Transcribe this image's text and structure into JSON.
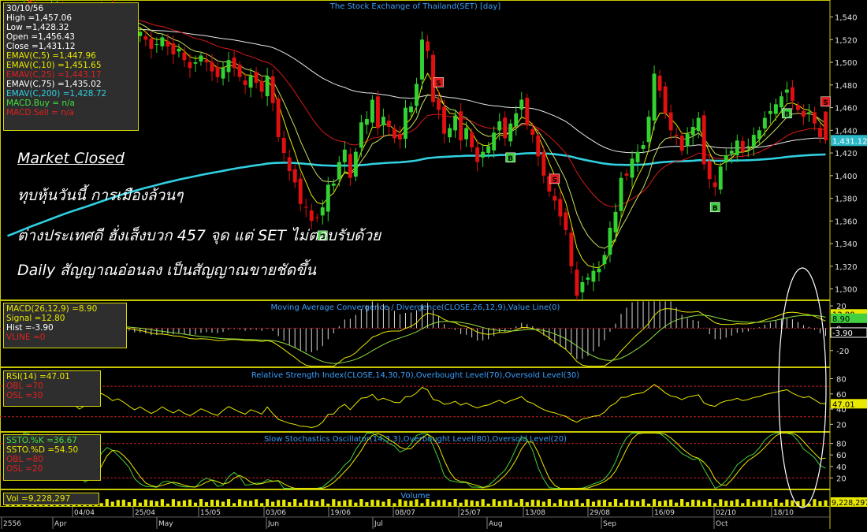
{
  "chart_data": [
    {
      "type": "candlestick",
      "title": "The Stock Exchange of Thailand(SET) [day]",
      "yticks": [
        1300,
        1320,
        1340,
        1360,
        1380,
        1400,
        1420,
        1440,
        1460,
        1480,
        1500,
        1520,
        1540
      ],
      "ylim": [
        1290,
        1555
      ],
      "last_value_label": "1,431.12",
      "ytick_labels": [
        "1,300",
        "1,320",
        "1,340",
        "1,360",
        "1,380",
        "1,400",
        "1,420",
        "1,440",
        "1,460",
        "1,480",
        "1,500",
        "1,520",
        "1,540"
      ],
      "x_date_labels": [
        "04/04",
        "25/04",
        "15/05",
        "03/06",
        "19/06",
        "08/07",
        "25/07",
        "13/08",
        "29/08",
        "16/09",
        "02/10",
        "18/10"
      ],
      "x_month_labels": [
        "2556",
        "Apr",
        "May",
        "Jun",
        "Jul",
        "Aug",
        "Sep",
        "Oct"
      ],
      "closes": [
        1527,
        1535,
        1545,
        1552,
        1549,
        1544,
        1538,
        1542,
        1548,
        1553,
        1547,
        1540,
        1533,
        1526,
        1530,
        1537,
        1543,
        1549,
        1545,
        1539,
        1542,
        1537,
        1530,
        1523,
        1527,
        1520,
        1512,
        1516,
        1522,
        1514,
        1507,
        1512,
        1502,
        1495,
        1500,
        1506,
        1500,
        1492,
        1487,
        1495,
        1502,
        1495,
        1487,
        1480,
        1488,
        1482,
        1474,
        1488,
        1464,
        1434,
        1420,
        1404,
        1394,
        1375,
        1372,
        1360,
        1363,
        1372,
        1392,
        1393,
        1412,
        1423,
        1398,
        1421,
        1447,
        1450,
        1467,
        1442,
        1452,
        1443,
        1433,
        1432,
        1460,
        1461,
        1481,
        1520,
        1510,
        1465,
        1458,
        1437,
        1442,
        1453,
        1431,
        1442,
        1425,
        1412,
        1421,
        1426,
        1438,
        1448,
        1433,
        1446,
        1455,
        1467,
        1445,
        1436,
        1417,
        1400,
        1386,
        1378,
        1364,
        1352,
        1320,
        1294,
        1306,
        1310,
        1316,
        1318,
        1330,
        1354,
        1368,
        1398,
        1400,
        1415,
        1421,
        1427,
        1452,
        1490,
        1475,
        1455,
        1440,
        1435,
        1422,
        1437,
        1443,
        1451,
        1410,
        1397,
        1390,
        1408,
        1418,
        1422,
        1431,
        1421,
        1426,
        1436,
        1440,
        1451,
        1457,
        1463,
        1470,
        1476,
        1466,
        1458,
        1452,
        1456,
        1446,
        1434,
        1431
      ],
      "emav5": [
        1447.96
      ],
      "emav10": [
        1451.65
      ],
      "emav25": [
        1443.17
      ],
      "emav75": [
        1435.02
      ],
      "emav200": [
        1428.72
      ],
      "signals": [
        {
          "label": "B",
          "type": "buy"
        },
        {
          "label": "S",
          "type": "sell"
        },
        {
          "label": "B",
          "type": "buy"
        },
        {
          "label": "S",
          "type": "sell"
        },
        {
          "label": "B",
          "type": "buy"
        },
        {
          "label": "B",
          "type": "buy"
        },
        {
          "label": "S",
          "type": "sell"
        }
      ],
      "signal_index": [
        57,
        78,
        91,
        99,
        128,
        141,
        148
      ]
    },
    {
      "type": "macd",
      "title": "Moving Average Convergence / Divergence(CLOSE,26,12,9),Value Line(0)",
      "ytick_labels": [
        "20",
        "0",
        "-20"
      ],
      "yticks": [
        20,
        0,
        -20
      ],
      "ylim": [
        -35,
        25
      ],
      "value_labels": [
        "12.80",
        "8.90",
        "-3.90"
      ],
      "macd": 8.9,
      "signal": 12.8,
      "hist": -3.9,
      "vline": 0
    },
    {
      "type": "rsi",
      "title": "Relative Strength Index(CLOSE,14,30,70),Overbought Level(70),Oversold Level(30)",
      "ytick_labels": [
        "80",
        "60",
        "40",
        "20"
      ],
      "yticks": [
        80,
        60,
        40,
        20
      ],
      "ylim": [
        10,
        95
      ],
      "value_label": "47.01",
      "rsi": 47.01,
      "obl": 70,
      "osl": 30
    },
    {
      "type": "stochastic",
      "title": "Slow Stochastics Oscillator(14,3,3),Overbought Level(80),Oversold Level(20)",
      "ytick_labels": [
        "80",
        "60",
        "40",
        "20"
      ],
      "yticks": [
        80,
        60,
        40,
        20
      ],
      "ylim": [
        0,
        100
      ],
      "k": 36.67,
      "d": 54.5,
      "obl": 80,
      "osl": 20
    },
    {
      "type": "bar",
      "title": "Volume",
      "value_label": "9,228,297",
      "last_volume": 9228297
    }
  ],
  "main_info": {
    "date": "30/10/56",
    "high": "High  =1,457.06",
    "low": "Low  =1,428.32",
    "open": "Open  =1,456.43",
    "close": "Close  =1,431.12",
    "emav5": "EMAV(C,5)  =1,447.96",
    "emav10": "EMAV(C,10)  =1,451.65",
    "emav25": "EMAV(C,25)  =1,443.17",
    "emav75": "EMAV(C,75)  =1,435.02",
    "emav200": "EMAV(C,200)  =1,428.72",
    "macd_buy": "MACD.Buy  = n/a",
    "macd_sell": "MACD.Sell  = n/a"
  },
  "macd_info": {
    "macd": "MACD(26,12,9)  =8.90",
    "signal": "Signal  =12.80",
    "hist": "Hist  =-3.90",
    "vline": "VLINE  =0"
  },
  "rsi_info": {
    "rsi": "RSI(14)  =47.01",
    "obl": "OBL  =70",
    "osl": "OSL  =30"
  },
  "ssto_info": {
    "k": "SSTO.%K  =36.67",
    "d": "SSTO.%D  =54.50",
    "obl": "OBL  =80",
    "osl": "OSL  =20"
  },
  "vol_info": {
    "vol": "Vol  =9,228,297"
  },
  "commentary": [
    "Market Closed",
    "ทุบหุ้นวันนี้ การเมืองล้วนๆ",
    "ต่างประเทศดี ฮั่งเส็งบวก 457 จุด แต่ SET ไม่ตอบรับด้วย",
    "Daily สัญญาณอ่อนลง เป็นสัญญาณขายชัดขึ้น"
  ],
  "colors": {
    "background": "#000000",
    "candle_up": "#32d232",
    "candle_down": "#e01010",
    "emav5": "#e8e800",
    "emav10": "#c8e060",
    "emav25": "#d81818",
    "emav75": "#e8e8e8",
    "emav200": "#30d0e0",
    "panel_border": "#c8c800",
    "title_text": "#3aa0ff",
    "buy": "#40d040",
    "sell": "#e01818"
  }
}
